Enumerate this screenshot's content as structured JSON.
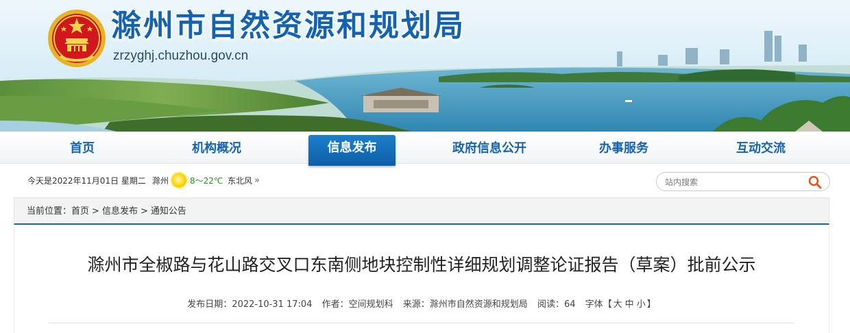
{
  "site": {
    "title": "滁州市自然资源和规划局",
    "url": "zrzyghj.chuzhou.gov.cn"
  },
  "nav": {
    "items": [
      {
        "label": "首页"
      },
      {
        "label": "机构概况"
      },
      {
        "label": "信息发布",
        "active": true
      },
      {
        "label": "政府信息公开"
      },
      {
        "label": "办事服务"
      },
      {
        "label": "互动交流"
      }
    ]
  },
  "info": {
    "date": "今天是2022年11月01日 星期二",
    "city": "滁州",
    "weather_icon": "sun-icon",
    "temp": "8～22℃",
    "wind": "东北风",
    "more": "»"
  },
  "search": {
    "placeholder": "站内搜索",
    "icon": "search-icon"
  },
  "breadcrumb": {
    "prefix": "当前位置：",
    "items": [
      "首页",
      "信息发布",
      "通知公告"
    ],
    "separator": ">"
  },
  "article": {
    "title": "滁州市全椒路与花山路交叉口东南侧地块控制性详细规划调整论证报告（草案）批前公示",
    "meta": {
      "date_label": "发布日期：",
      "date": "2022-10-31 17:04",
      "author_label": "作者：",
      "author": "空间规划科",
      "source_label": "来源：",
      "source": "滁州市自然资源和规划局",
      "reads_label": "阅读：",
      "reads": "64",
      "font_label": "字体【",
      "font_large": "大",
      "font_medium": "中",
      "font_small": "小",
      "font_close": "】"
    }
  },
  "colors": {
    "brand_blue": "#1463b2",
    "nav_active": "#0d5fa6",
    "temp_green": "#199619"
  }
}
